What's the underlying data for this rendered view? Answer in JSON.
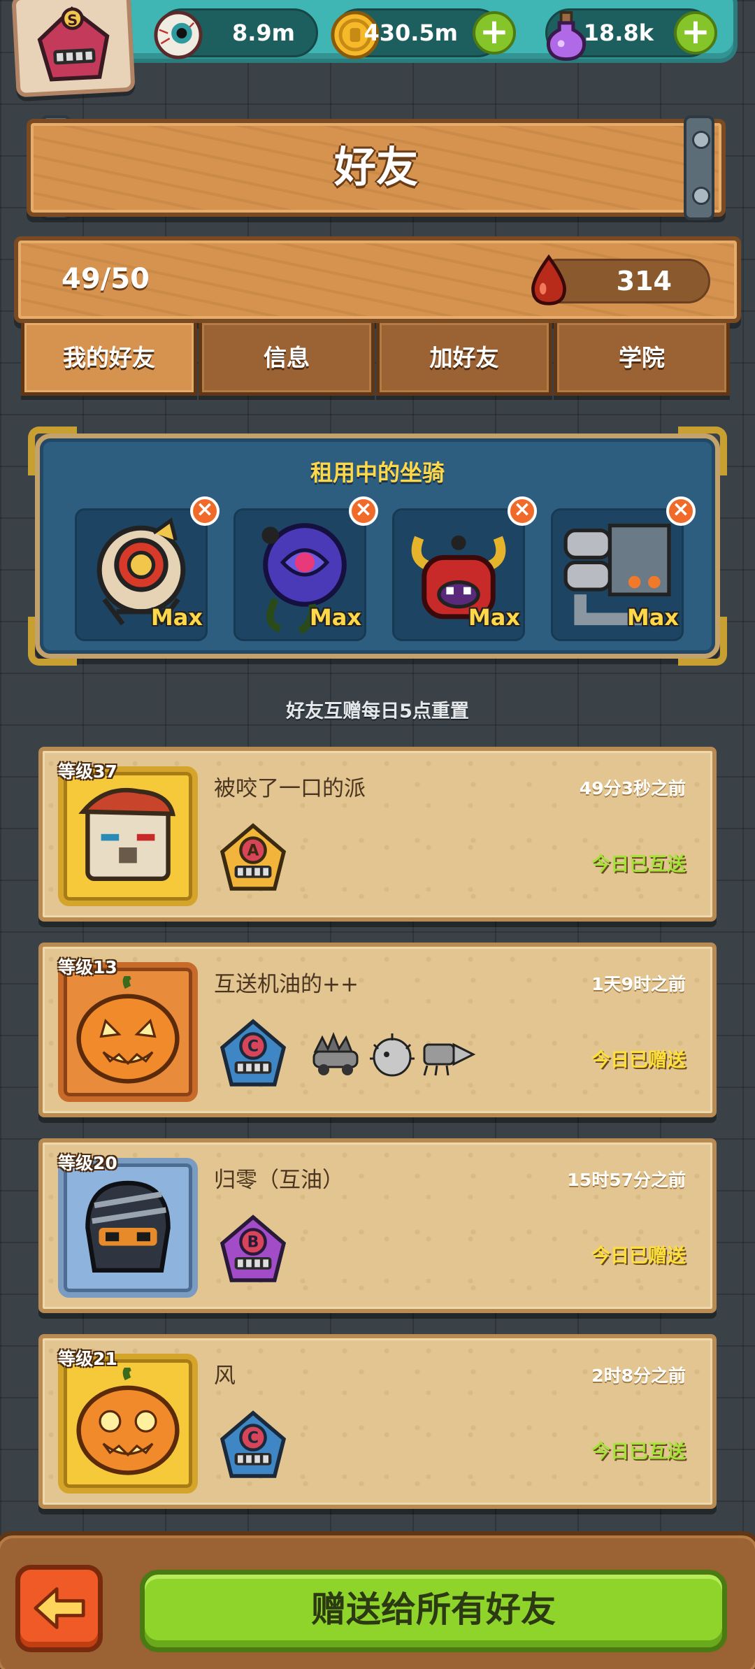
{
  "resources": {
    "eyes": {
      "value": "8.9m",
      "icon": "eyeball-icon"
    },
    "coins": {
      "value": "430.5m",
      "icon": "coin-icon"
    },
    "potion": {
      "value": "18.8k",
      "icon": "potion-icon"
    }
  },
  "player": {
    "rank": "S"
  },
  "title": "好友",
  "stats": {
    "friend_count": "49/50",
    "blood": "314"
  },
  "tabs": [
    {
      "label": "我的好友",
      "active": true
    },
    {
      "label": "信息",
      "active": false
    },
    {
      "label": "加好友",
      "active": false
    },
    {
      "label": "学院",
      "active": false
    }
  ],
  "mounts": {
    "heading": "租用中的坐骑",
    "items": [
      {
        "name": "lion-dance-mount",
        "level": "Max"
      },
      {
        "name": "rose-mount",
        "level": "Max"
      },
      {
        "name": "demon-mount",
        "level": "Max"
      },
      {
        "name": "machine-mount",
        "level": "Max"
      }
    ]
  },
  "reset_note": "好友互赠每日5点重置",
  "friends": [
    {
      "level": "等级37",
      "name": "被咬了一口的派",
      "time": "49分3秒之前",
      "status": "今日已互送",
      "status_color": "green",
      "rank": "A",
      "avatar": "box-robot"
    },
    {
      "level": "等级13",
      "name": "互送机油的++",
      "time": "1天9时之前",
      "status": "今日已赠送",
      "status_color": "yellow",
      "rank": "C",
      "avatar": "pumpkin"
    },
    {
      "level": "等级20",
      "name": "归零（互油）",
      "time": "15时57分之前",
      "status": "今日已赠送",
      "status_color": "yellow",
      "rank": "B",
      "avatar": "ninja"
    },
    {
      "level": "等级21",
      "name": "风",
      "time": "2时8分之前",
      "status": "今日已互送",
      "status_color": "green",
      "rank": "C",
      "avatar": "pumpkin"
    }
  ],
  "bottom": {
    "gift_all_label": "赠送给所有好友"
  },
  "colors": {
    "rank_a": "#f2b43a",
    "rank_b": "#a24cc8",
    "rank_c": "#3e86c4",
    "rank_s": "#c43a5a"
  }
}
